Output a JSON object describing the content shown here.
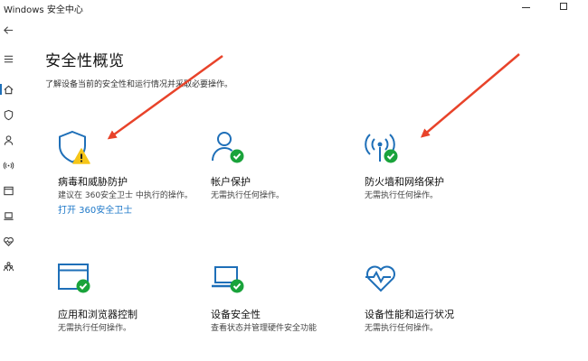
{
  "window": {
    "title": "Windows 安全中心"
  },
  "colors": {
    "accent": "#1e6fb8",
    "ok": "#1aa33b",
    "warning": "#f5c518",
    "annotation": "#e8432a"
  },
  "nav": [
    {
      "icon": "back-arrow-icon"
    },
    {
      "icon": "menu-icon"
    },
    {
      "icon": "home-icon"
    },
    {
      "icon": "shield-icon"
    },
    {
      "icon": "person-icon"
    },
    {
      "icon": "wireless-icon"
    },
    {
      "icon": "browser-window-icon"
    },
    {
      "icon": "laptop-icon"
    },
    {
      "icon": "heart-pulse-icon"
    },
    {
      "icon": "family-icon"
    }
  ],
  "main": {
    "title": "安全性概览",
    "subtitle": "了解设备当前的安全性和运行情况并采取必要操作。"
  },
  "tiles": [
    {
      "icon": "virus-shield-warning-icon",
      "title": "病毒和威胁防护",
      "desc": "建议在 360安全卫士 中执行的操作。",
      "link": "打开 360安全卫士"
    },
    {
      "icon": "account-protection-icon",
      "title": "帐户保护",
      "desc": "无需执行任何操作。"
    },
    {
      "icon": "firewall-network-icon",
      "title": "防火墙和网络保护",
      "desc": "无需执行任何操作。"
    },
    {
      "icon": "app-browser-control-icon",
      "title": "应用和浏览器控制",
      "desc": "无需执行任何操作。"
    },
    {
      "icon": "device-security-icon",
      "title": "设备安全性",
      "desc": "查看状态并管理硬件安全功能"
    },
    {
      "icon": "device-performance-icon",
      "title": "设备性能和运行状况",
      "desc": "无需执行任何操作。"
    }
  ]
}
